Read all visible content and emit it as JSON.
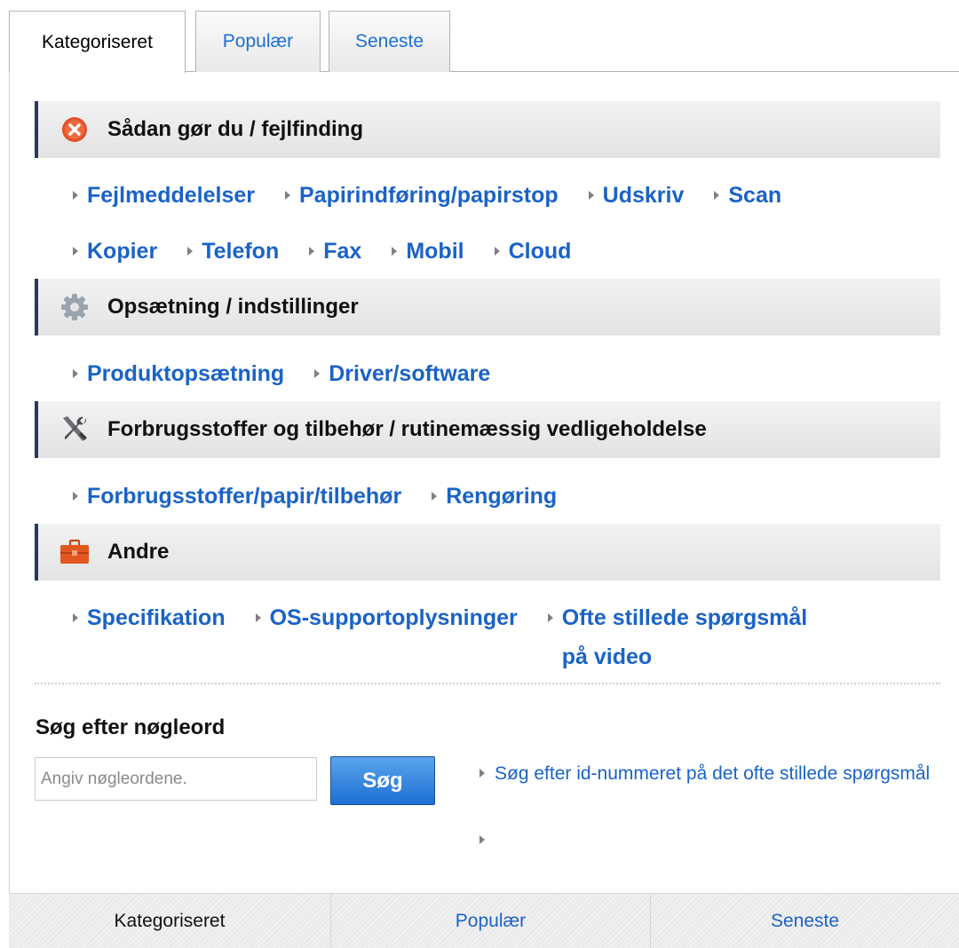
{
  "tabs": {
    "categorized": "Kategoriseret",
    "popular": "Populær",
    "latest": "Seneste"
  },
  "sections": [
    {
      "title": "Sådan gør du / fejlfinding",
      "icon": "error-x-icon",
      "links": [
        "Fejlmeddelelser",
        "Papirindføring/papirstop",
        "Udskriv",
        "Scan",
        "Kopier",
        "Telefon",
        "Fax",
        "Mobil",
        "Cloud"
      ]
    },
    {
      "title": "Opsætning / indstillinger",
      "icon": "gear-icon",
      "links": [
        "Produktopsætning",
        "Driver/software"
      ]
    },
    {
      "title": "Forbrugsstoffer og tilbehør / rutinemæssig vedligeholdelse",
      "icon": "tools-icon",
      "links": [
        "Forbrugsstoffer/papir/tilbehør",
        "Rengøring"
      ]
    },
    {
      "title": "Andre",
      "icon": "toolbox-icon",
      "links": [
        "Specifikation",
        "OS-supportoplysninger",
        "Ofte stillede spørgsmål på video"
      ]
    }
  ],
  "search": {
    "title": "Søg efter nøgleord",
    "placeholder": "Angiv nøgleordene.",
    "button": "Søg",
    "faq_id_link": "Søg efter id-nummeret på det ofte stillede spørgsmål"
  },
  "bottom_tabs": {
    "categorized": "Kategoriseret",
    "popular": "Populær",
    "latest": "Seneste"
  },
  "colors": {
    "link": "#1a63c6",
    "header_accent": "#253a5e",
    "button": "#1d6fd3"
  }
}
